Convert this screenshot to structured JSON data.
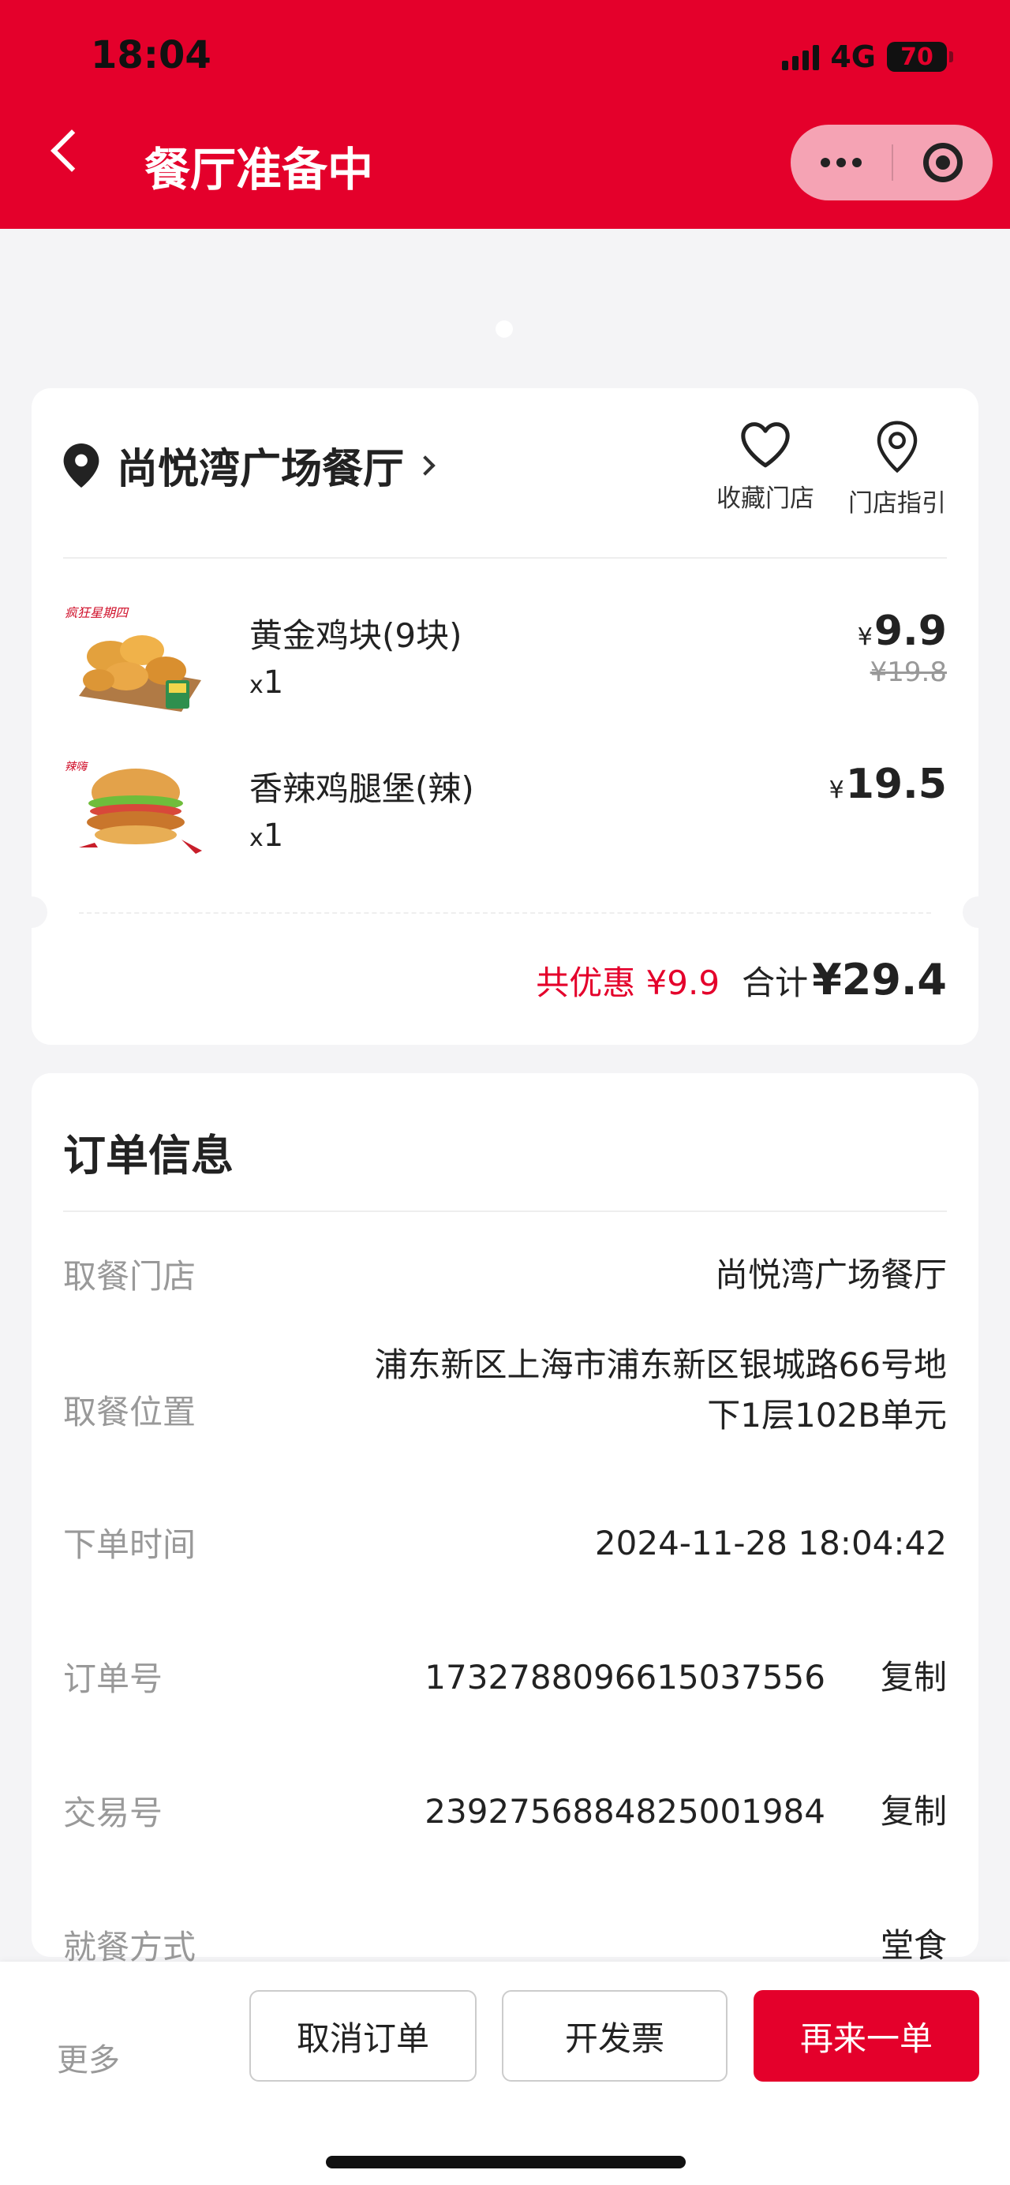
{
  "status_bar": {
    "time": "18:04",
    "network": "4G",
    "battery": "70"
  },
  "header": {
    "title": "餐厅准备中"
  },
  "store": {
    "name": "尚悦湾广场餐厅",
    "actions": [
      {
        "label": "收藏门店"
      },
      {
        "label": "门店指引"
      }
    ]
  },
  "items": [
    {
      "name": "黄金鸡块(9块)",
      "qty_prefix": "x",
      "qty": "1",
      "currency": "¥",
      "price": "9.9",
      "original_price": "¥19.8"
    },
    {
      "name": "香辣鸡腿堡(辣)",
      "qty_prefix": "x",
      "qty": "1",
      "currency": "¥",
      "price": "19.5"
    }
  ],
  "summary": {
    "discount": "共优惠 ¥9.9",
    "total_label": "合计",
    "total": "¥29.4"
  },
  "order_info": {
    "title": "订单信息",
    "rows": [
      {
        "label": "取餐门店",
        "value": "尚悦湾广场餐厅"
      },
      {
        "label": "取餐位置",
        "value_line1": "浦东新区上海市浦东新区银城路66号地",
        "value_line2": "下1层102B单元"
      },
      {
        "label": "下单时间",
        "value": "2024-11-28 18:04:42"
      },
      {
        "label": "订单号",
        "value": "1732788096615037556",
        "action": "复制"
      },
      {
        "label": "交易号",
        "value": "2392756884825001984",
        "action": "复制"
      },
      {
        "label": "就餐方式",
        "value": "堂食"
      }
    ]
  },
  "bottom_bar": {
    "more": "更多",
    "cancel": "取消订单",
    "invoice": "开发票",
    "reorder": "再来一单"
  },
  "colors": {
    "brand": "#e4002b"
  }
}
